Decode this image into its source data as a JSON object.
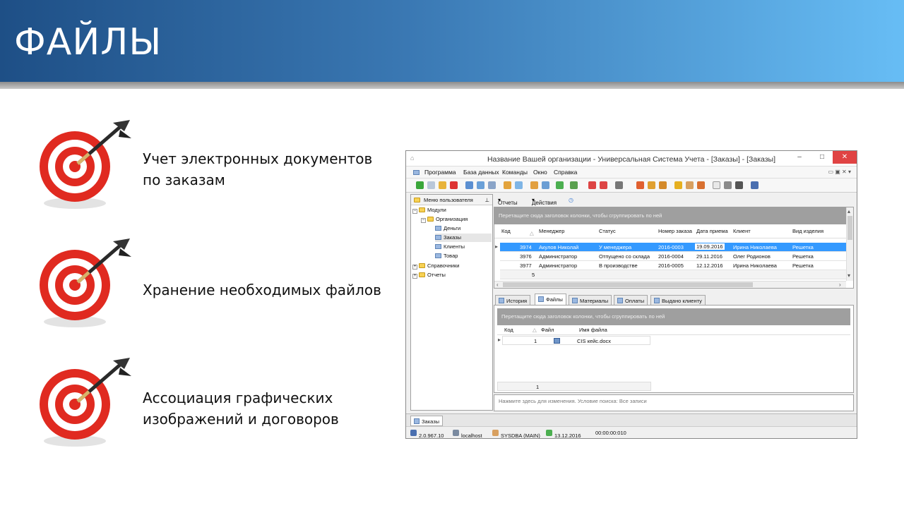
{
  "slide": {
    "title": "ФАЙЛЫ",
    "bullets": [
      {
        "text": "Учет электронных документов\nпо заказам",
        "icon": "dart-target-icon"
      },
      {
        "text": "Хранение необходимых файлов",
        "icon": "dart-target-icon"
      },
      {
        "text": "Ассоциация графических\nизображений и договоров",
        "icon": "dart-target-icon"
      }
    ]
  },
  "app": {
    "window_title": "Название Вашей организации - Универсальная Система Учета - [Заказы] - [Заказы]",
    "menu": [
      "Программа",
      "База данных",
      "Команды",
      "Окно",
      "Справка"
    ],
    "nav_panel": {
      "title": "Меню пользователя",
      "tree": [
        {
          "label": "Модули",
          "type": "folder",
          "expanded": true
        },
        {
          "label": "Организация",
          "type": "folder",
          "expanded": true
        },
        {
          "label": "Деньги",
          "type": "grid"
        },
        {
          "label": "Заказы",
          "type": "grid",
          "selected": true
        },
        {
          "label": "Клиенты",
          "type": "grid"
        },
        {
          "label": "Товар",
          "type": "grid"
        },
        {
          "label": "Справочники",
          "type": "folder",
          "expanded": false
        },
        {
          "label": "Отчеты",
          "type": "folder",
          "expanded": false
        }
      ]
    },
    "orders_toolbar": {
      "reports": "Отчеты",
      "actions": "Действия"
    },
    "orders_grid": {
      "group_hint": "Перетащите сюда заголовок колонки, чтобы сгруппировать по ней",
      "columns": [
        "Код",
        "Менеджер",
        "Статус",
        "Номер заказа",
        "Дата приема",
        "Клиент",
        "Вид изделия"
      ],
      "rows": [
        {
          "code": "3974",
          "manager": "Акулов Николай",
          "status": "У менеджера",
          "order_no": "2016-0003",
          "date": "19.09.2016",
          "client": "Ирина Николаева",
          "product": "Решетка",
          "selected": true
        },
        {
          "code": "3976",
          "manager": "Администратор",
          "status": "Отпущено со склада",
          "order_no": "2016-0004",
          "date": "29.11.2016",
          "client": "Олег Родионов",
          "product": "Решетка"
        },
        {
          "code": "3977",
          "manager": "Администратор",
          "status": "В производстве",
          "order_no": "2016-0005",
          "date": "12.12.2016",
          "client": "Ирина Николаева",
          "product": "Решетка"
        }
      ],
      "footer_count": "5"
    },
    "detail_tabs": [
      {
        "label": "История"
      },
      {
        "label": "Файлы",
        "active": true
      },
      {
        "label": "Материалы"
      },
      {
        "label": "Оплаты"
      },
      {
        "label": "Выдано клиенту"
      }
    ],
    "files_grid": {
      "group_hint": "Перетащите сюда заголовок колонки, чтобы сгруппировать по ней",
      "columns": [
        "Код",
        "Файл",
        "Имя файла"
      ],
      "rows": [
        {
          "code": "1",
          "file_icon": "word-document-icon",
          "name": "CIS кейс.docx"
        }
      ],
      "footer_count": "1"
    },
    "filter_hint": "Нажмите здесь для изменения. Условие поиска: Все записи",
    "bottom_tab": "Заказы",
    "status": {
      "version": "2.0.967.10",
      "server": "localhost",
      "user": "SYSDBA (MAIN)",
      "date": "13.12.2016",
      "timer": "00:00:00:010"
    }
  },
  "colors": {
    "banner_start": "#1e4f86",
    "banner_end": "#67bdf5",
    "selection": "#3399ff",
    "target_red": "#e02a20"
  }
}
